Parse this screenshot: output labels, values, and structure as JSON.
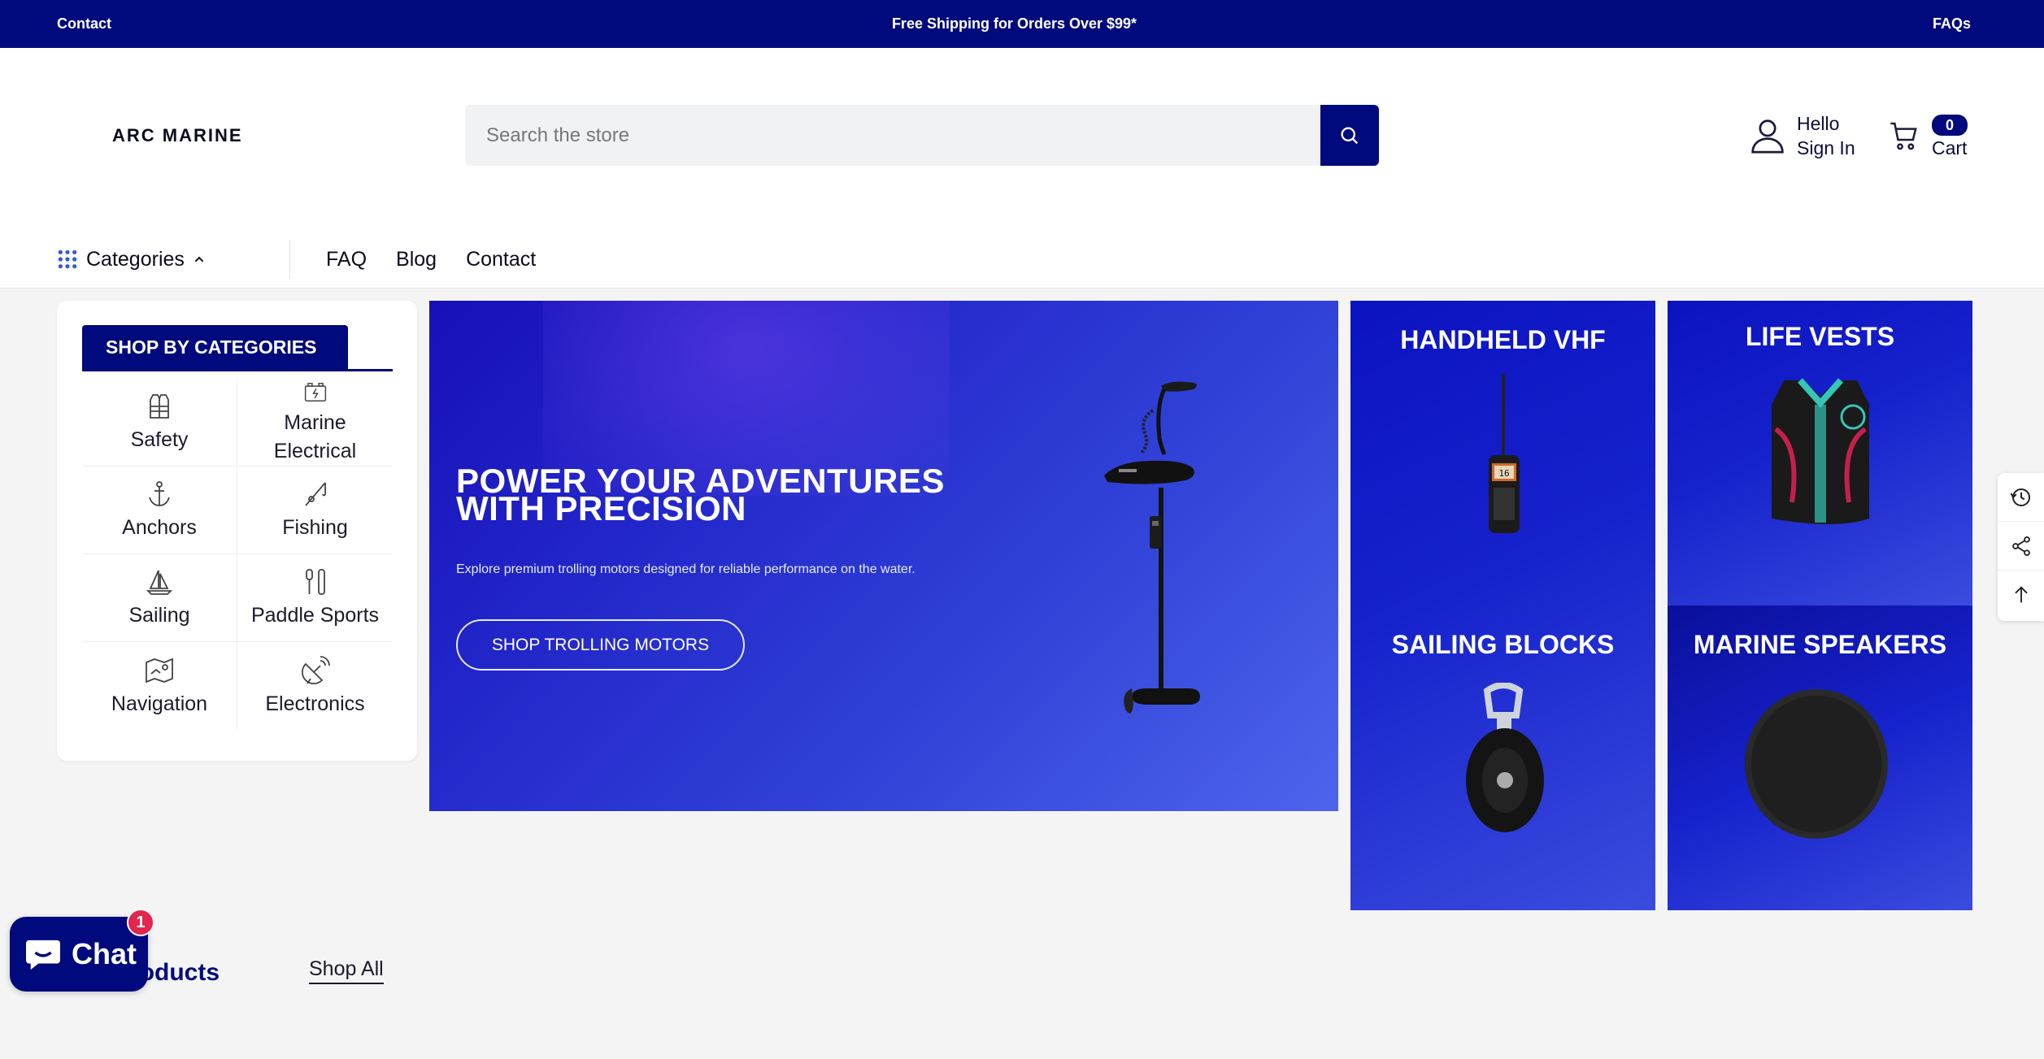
{
  "topbar": {
    "left_link": "Contact",
    "announcement": "Free Shipping for Orders Over $99*",
    "right_link": "FAQs"
  },
  "header": {
    "logo": "ARC MARINE",
    "search_placeholder": "Search the store",
    "account_greeting": "Hello",
    "account_action": "Sign In",
    "cart_label": "Cart",
    "cart_count": "0"
  },
  "nav": {
    "categories_label": "Categories",
    "links": [
      "FAQ",
      "Blog",
      "Contact"
    ]
  },
  "categories_panel": {
    "title": "SHOP BY CATEGORIES",
    "items": [
      {
        "label": "Safety",
        "icon": "life-vest-icon"
      },
      {
        "label": "Marine Electrical",
        "icon": "battery-icon"
      },
      {
        "label": "Anchors",
        "icon": "anchor-icon"
      },
      {
        "label": "Fishing",
        "icon": "fishing-rod-icon"
      },
      {
        "label": "Sailing",
        "icon": "sailboat-icon"
      },
      {
        "label": "Paddle Sports",
        "icon": "paddle-icon"
      },
      {
        "label": "Navigation",
        "icon": "map-icon"
      },
      {
        "label": "Electronics",
        "icon": "satellite-dish-icon"
      }
    ]
  },
  "hero": {
    "title_line1": "POWER YOUR ADVENTURES",
    "title_line2": "WITH PRECISION",
    "subtitle": "Explore premium trolling motors designed for reliable performance on the water.",
    "cta": "SHOP TROLLING MOTORS"
  },
  "tiles": {
    "handheld_vhf": "HANDHELD VHF",
    "life_vests": "LIFE VESTS",
    "sailing_blocks": "SAILING BLOCKS",
    "marine_speakers": "MARINE SPEAKERS"
  },
  "section": {
    "title": "r Products",
    "shop_all": "Shop All"
  },
  "chat": {
    "label": "Chat",
    "badge": "1"
  },
  "colors": {
    "brand_navy": "#000a7c",
    "hero_blue": "#2226c9",
    "badge_red": "#e2264d"
  }
}
